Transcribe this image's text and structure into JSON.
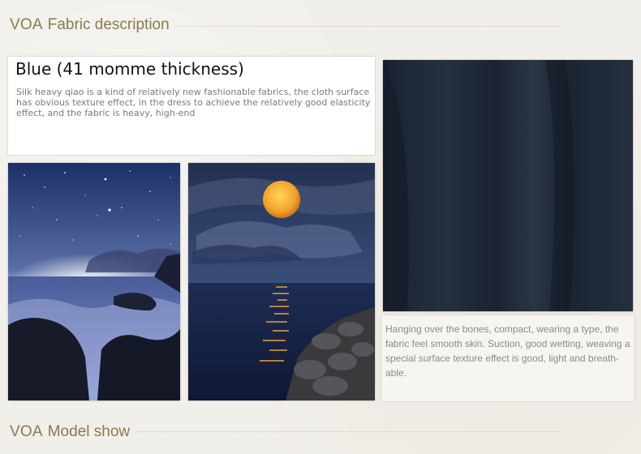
{
  "header_top": {
    "brand": "VOA",
    "label": "Fabric description"
  },
  "description": {
    "title": "Blue (41 momme thickness)",
    "text": "Silk heavy qiao is a kind of relatively new fashionable fabrics, the cloth surface has obvious texture effect, in the dress to achieve the relatively good elasticity effect, and the fabric is heavy, high-end"
  },
  "fabric_caption": "Hanging over the bones, compact, wearing a type, the fabric feel smooth skin. Suction, good wetting, weaving a special surface texture effect is good, light and breath- able.",
  "header_bottom": {
    "brand": "VOA",
    "label": "Model show"
  },
  "colors": {
    "heading": "#8b7a4e",
    "fabric": "#1e2735",
    "background": "#f1efe9"
  }
}
